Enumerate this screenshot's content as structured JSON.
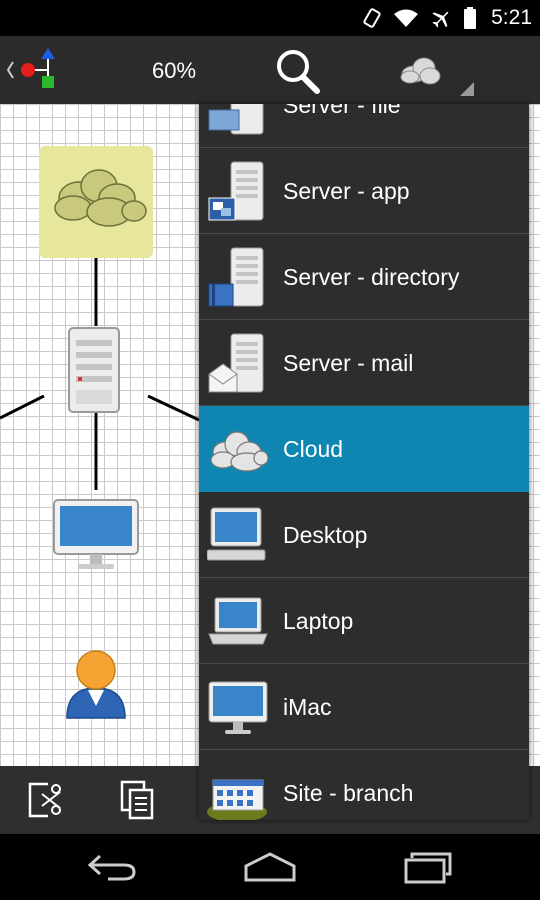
{
  "status": {
    "time": "5:21"
  },
  "toolbar": {
    "zoom": "60%"
  },
  "dropdown": {
    "items": [
      {
        "label": "Server - file",
        "icon": "server-file-icon"
      },
      {
        "label": "Server - app",
        "icon": "server-app-icon"
      },
      {
        "label": "Server - directory",
        "icon": "server-directory-icon"
      },
      {
        "label": "Server - mail",
        "icon": "server-mail-icon"
      },
      {
        "label": "Cloud",
        "icon": "cloud-icon",
        "selected": true
      },
      {
        "label": "Desktop",
        "icon": "desktop-icon"
      },
      {
        "label": "Laptop",
        "icon": "laptop-icon"
      },
      {
        "label": "iMac",
        "icon": "imac-icon"
      },
      {
        "label": "Site - branch",
        "icon": "site-branch-icon"
      }
    ]
  },
  "colors": {
    "selected": "#0f85b2",
    "menu_bg": "#2d2d2d",
    "cloud_highlight": "#e6e79c"
  }
}
